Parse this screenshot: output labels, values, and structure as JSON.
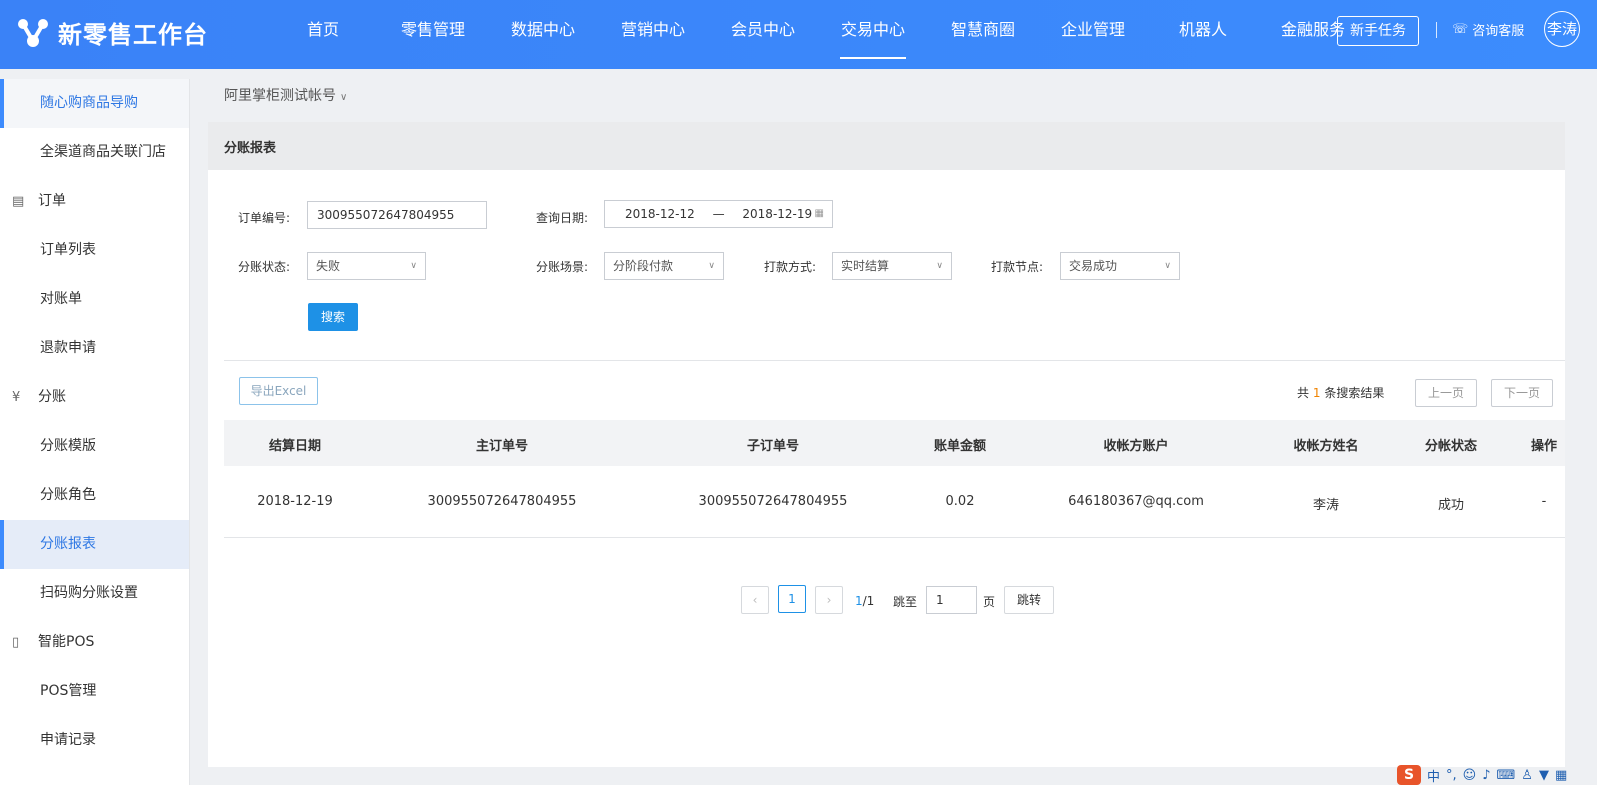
{
  "header": {
    "app_title": "新零售工作台",
    "nav": [
      "首页",
      "零售管理",
      "数据中心",
      "营销中心",
      "会员中心",
      "交易中心",
      "智慧商圈",
      "企业管理",
      "机器人",
      "金融服务"
    ],
    "active_nav": "交易中心",
    "new_task_label": "新手任务",
    "consult_label": "咨询客服",
    "user_name": "李涛"
  },
  "sidebar": {
    "items": [
      {
        "label": "随心购商品导购",
        "type": "item"
      },
      {
        "label": "全渠道商品关联门店",
        "type": "item"
      },
      {
        "label": "订单",
        "type": "group",
        "icon": "document-icon"
      },
      {
        "label": "订单列表",
        "type": "item"
      },
      {
        "label": "对账单",
        "type": "item"
      },
      {
        "label": "退款申请",
        "type": "item"
      },
      {
        "label": "分账",
        "type": "group",
        "icon": "yen-icon"
      },
      {
        "label": "分账模版",
        "type": "item"
      },
      {
        "label": "分账角色",
        "type": "item"
      },
      {
        "label": "分账报表",
        "type": "item"
      },
      {
        "label": "扫码购分账设置",
        "type": "item"
      },
      {
        "label": "智能POS",
        "type": "group",
        "icon": "pos-icon"
      },
      {
        "label": "POS管理",
        "type": "item"
      },
      {
        "label": "申请记录",
        "type": "item"
      }
    ],
    "active_item": "分账报表"
  },
  "main": {
    "account_label": "阿里掌柜测试帐号",
    "panel_title": "分账报表",
    "filters": {
      "order_no_label": "订单编号:",
      "order_no_value": "300955072647804955",
      "date_label": "查询日期:",
      "date_start": "2018-12-12",
      "date_sep": "—",
      "date_end": "2018-12-19",
      "status_label": "分账状态:",
      "status_value": "失败",
      "scene_label": "分账场景:",
      "scene_value": "分阶段付款",
      "pay_method_label": "打款方式:",
      "pay_method_value": "实时结算",
      "pay_node_label": "打款节点:",
      "pay_node_value": "交易成功",
      "search_label": "搜索"
    },
    "toolbar": {
      "export_label": "导出Excel",
      "result_prefix": "共",
      "result_count": "1",
      "result_suffix": "条搜索结果",
      "prev_label": "上一页",
      "next_label": "下一页"
    },
    "table": {
      "headers": [
        "结算日期",
        "主订单号",
        "子订单号",
        "账单金额",
        "收帐方账户",
        "收帐方姓名",
        "分帐状态",
        "操作"
      ],
      "rows": [
        [
          "2018-12-19",
          "300955072647804955",
          "300955072647804955",
          "0.02",
          "646180367@qq.com",
          "李涛",
          "成功",
          "-"
        ]
      ]
    },
    "pagination": {
      "prev_glyph": "‹",
      "current_page": "1",
      "next_glyph": "›",
      "fraction_current": "1",
      "fraction_total": "/1",
      "jump_prefix": "跳至",
      "jump_value": "1",
      "jump_suffix": "页",
      "jump_button": "跳转"
    }
  },
  "ime_tray": {
    "logo": "S",
    "mode": "中",
    "punct": "°,"
  },
  "colors": {
    "header_bg": "#3c8cfd",
    "accent": "#1e91e6",
    "result_count": "#f08300"
  }
}
